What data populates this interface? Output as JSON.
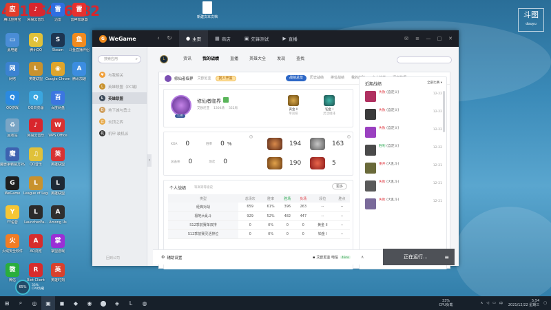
{
  "overlay_number": "45165446882",
  "corner_logo": {
    "main": "斗图",
    "sub": "douyu"
  },
  "desktop_file": {
    "label": "新建文本文档"
  },
  "desktop_icons": [
    {
      "id": "1",
      "label": "腾讯应用宝",
      "color": "#e23c2b",
      "g": "应"
    },
    {
      "id": "2",
      "label": "网易云音乐",
      "color": "#d8262d",
      "g": "♪"
    },
    {
      "id": "3",
      "label": "迅雷",
      "color": "#2f6ee0",
      "g": "雷"
    },
    {
      "id": "4",
      "label": "雷神加速器",
      "color": "#e8312e",
      "g": "雷"
    },
    {
      "id": "5",
      "label": "雷神游戏",
      "color": "#2a6fd6",
      "g": "✕"
    },
    {
      "id": "6",
      "label": "此电脑",
      "color": "#4a8dd6",
      "g": "▭"
    },
    {
      "id": "7",
      "label": "腾讯QQ",
      "color": "#e0c13a",
      "g": "Q"
    },
    {
      "id": "8",
      "label": "Steam",
      "color": "#1d3551",
      "g": "S"
    },
    {
      "id": "9",
      "label": "斗鱼直播伴侣",
      "color": "#f28b1f",
      "g": "鱼"
    },
    {
      "id": "10",
      "label": "网络",
      "color": "#3b82d1",
      "g": "网"
    },
    {
      "id": "11",
      "label": "英雄联盟",
      "color": "#c8922e",
      "g": "L"
    },
    {
      "id": "12",
      "label": "Google Chrome",
      "color": "#dfa52c",
      "g": "◉"
    },
    {
      "id": "13",
      "label": "腾讯加速",
      "color": "#3c8de0",
      "g": "A"
    },
    {
      "id": "14",
      "label": "QQ游戏",
      "color": "#2b8ae0",
      "g": "Q"
    },
    {
      "id": "15",
      "label": "QQ浏览器",
      "color": "#3aa6e0",
      "g": "Q"
    },
    {
      "id": "16",
      "label": "百度网盘",
      "color": "#3b76e0",
      "g": "百"
    },
    {
      "id": "17",
      "label": "回收站",
      "color": "#7aa5c5",
      "g": "♻"
    },
    {
      "id": "18",
      "label": "网易云音乐",
      "color": "#d8262d",
      "g": "♪"
    },
    {
      "id": "19",
      "label": "WPS Office",
      "color": "#d83232",
      "g": "W"
    },
    {
      "id": "20",
      "label": "魔兽争霸官方对战平台",
      "color": "#3d62b0",
      "g": "魔"
    },
    {
      "id": "21",
      "label": "QQ音乐",
      "color": "#e0c13a",
      "g": "♫"
    },
    {
      "id": "22",
      "label": "英雄联盟",
      "color": "#d83232",
      "g": "英"
    },
    {
      "id": "23",
      "label": "WeGame",
      "color": "#1e1e1e",
      "g": "G"
    },
    {
      "id": "24",
      "label": "League of Legends",
      "color": "#c8922e",
      "g": "L"
    },
    {
      "id": "25",
      "label": "英雄联盟",
      "color": "#1e2a36",
      "g": "L"
    },
    {
      "id": "26",
      "label": "YY语音",
      "color": "#f6c634",
      "g": "Y"
    },
    {
      "id": "27",
      "label": "LauncherPa...",
      "color": "#2b2b2b",
      "g": "L"
    },
    {
      "id": "28",
      "label": "Among Us",
      "color": "#2f2f2f",
      "g": "A"
    },
    {
      "id": "29",
      "label": "火绒安全软件",
      "color": "#f27d25",
      "g": "火"
    },
    {
      "id": "30",
      "label": "AQ浏览",
      "color": "#d62d2d",
      "g": "A"
    },
    {
      "id": "31",
      "label": "掌盟游戏",
      "color": "#9a2fd6",
      "g": "掌"
    },
    {
      "id": "32",
      "label": "微信",
      "color": "#2aae3c",
      "g": "微"
    },
    {
      "id": "33",
      "label": "Riot Client",
      "color": "#d82c2c",
      "g": "R"
    },
    {
      "id": "34",
      "label": "英雄时刻",
      "color": "#d8412d",
      "g": "英"
    }
  ],
  "cpu_widget": {
    "value": "65%",
    "label1": "33%",
    "label2": "CPU负载"
  },
  "wegame": {
    "logo": "WeGame",
    "nav_back": "‹",
    "nav_refresh": "↻",
    "top_tabs": [
      {
        "label": "主页",
        "icon": "●"
      },
      {
        "label": "商店",
        "icon": "▦"
      },
      {
        "label": "先锋测试",
        "icon": "▣"
      },
      {
        "label": "直播",
        "icon": "▶"
      }
    ],
    "window_controls": [
      "✉",
      "≡",
      "—",
      "□",
      "✕"
    ],
    "sidebar": {
      "search_placeholder": "搜索应用",
      "items": [
        {
          "label": "与我相关",
          "color": "#f0a03c",
          "g": "♥"
        },
        {
          "label": "英雄联盟（PC端）",
          "color": "#c8922e",
          "g": "L"
        },
        {
          "label": "英雄联盟",
          "color": "#3c4a5a",
          "g": "L"
        },
        {
          "label": "地下城与勇士",
          "color": "#d0a060",
          "g": "D"
        },
        {
          "label": "云顶之弈",
          "color": "#e6a94a",
          "g": "云"
        },
        {
          "label": "机甲·装机派",
          "color": "#333",
          "g": "机"
        }
      ],
      "footer": "回到公司"
    },
    "collapse": "‹",
    "subtabs": [
      "资讯",
      "我的战绩",
      "直播",
      "英雄大全",
      "发现",
      "查找"
    ],
    "subsearch_placeholder": "",
    "profile_header": {
      "name": "修仙者临界",
      "link": "艾欧尼亚",
      "badge": "找人开黑"
    },
    "range_tabs": [
      "战绩总览",
      "历史战绩",
      "排位战绩",
      "我的皮肤",
      "个人荣誉",
      "深度数据"
    ],
    "profile": {
      "name": "修仙者临界",
      "server": "艾欧尼亚",
      "level_label": "130",
      "sub1": "1304场",
      "sub2": "322局"
    },
    "ranks": [
      {
        "label": "黄金 II",
        "sub": "单双排",
        "cls": "gold"
      },
      {
        "label": "铂金 I",
        "sub": "灵活组排",
        "cls": "plat"
      }
    ],
    "stats": {
      "kda_label": "KDA",
      "kda": "0",
      "win_label": "胜率",
      "win": "0",
      "win_pct": "%",
      "mvp_label": "总击杀",
      "mvp": "0",
      "five_label": "场次",
      "five": "0"
    },
    "honors": [
      "194",
      "163",
      "190",
      "5"
    ],
    "records": {
      "title": "个人战绩",
      "link": "等高等等级说",
      "more": "更多",
      "headers": [
        "类型",
        "总场次",
        "胜率",
        "胜场",
        "负场",
        "段位",
        "胜点"
      ],
      "rows": [
        [
          "经典对战",
          "659",
          "61%",
          "396",
          "263",
          "--",
          "--"
        ],
        [
          "极地大乱斗",
          "929",
          "52%",
          "482",
          "447",
          "--",
          "--"
        ],
        [
          "S12季前赛单双排",
          "0",
          "0%",
          "0",
          "0",
          "黄金 II",
          "--"
        ],
        [
          "S12季前赛灵活排位",
          "0",
          "0%",
          "0",
          "0",
          "铂金 I",
          "--"
        ]
      ]
    },
    "recent": {
      "title": "近期战绩",
      "filter": "全部比赛 ▾",
      "items": [
        {
          "result": "失败",
          "mode": "(自定义)",
          "badge": "",
          "date": "12-22",
          "color": "#b03060",
          "cls": "lose"
        },
        {
          "result": "失败",
          "mode": "(自定义)",
          "badge": "",
          "date": "12-22",
          "color": "#3a3a3a",
          "cls": "lose"
        },
        {
          "result": "失败",
          "mode": "(自定义)",
          "badge": "",
          "date": "12-22",
          "color": "#9a40c0",
          "cls": "lose"
        },
        {
          "result": "胜利",
          "mode": "(自定义)",
          "badge": "",
          "date": "12-22",
          "color": "#4a4a4a",
          "cls": "win"
        },
        {
          "result": "重开",
          "mode": "(大乱斗)",
          "badge": "",
          "date": "12-21",
          "color": "#6a6a3a",
          "cls": "lose"
        },
        {
          "result": "失败",
          "mode": "(大乱斗)",
          "badge": "",
          "date": "12-21",
          "color": "#5a5a5a",
          "cls": "lose"
        },
        {
          "result": "失败",
          "mode": "(大乱斗)",
          "badge": "",
          "date": "12-21",
          "color": "#7a6a9a",
          "cls": "lose"
        }
      ]
    },
    "bottom": {
      "assist": "辅助设置",
      "server": "艾欧尼亚 电信",
      "ping": "46ms",
      "chev": "∧",
      "run": "正在运行..."
    }
  },
  "taskbar": {
    "icons": [
      "⊞",
      "⌕",
      "◎",
      "▣",
      "◼",
      "◆",
      "◉",
      "⬤",
      "◈",
      "L",
      "◍"
    ],
    "tray_cpu_val": "33%",
    "tray_cpu_lbl": "CPU负载",
    "time": "5:54",
    "date": "2021/12/22 星期三"
  }
}
